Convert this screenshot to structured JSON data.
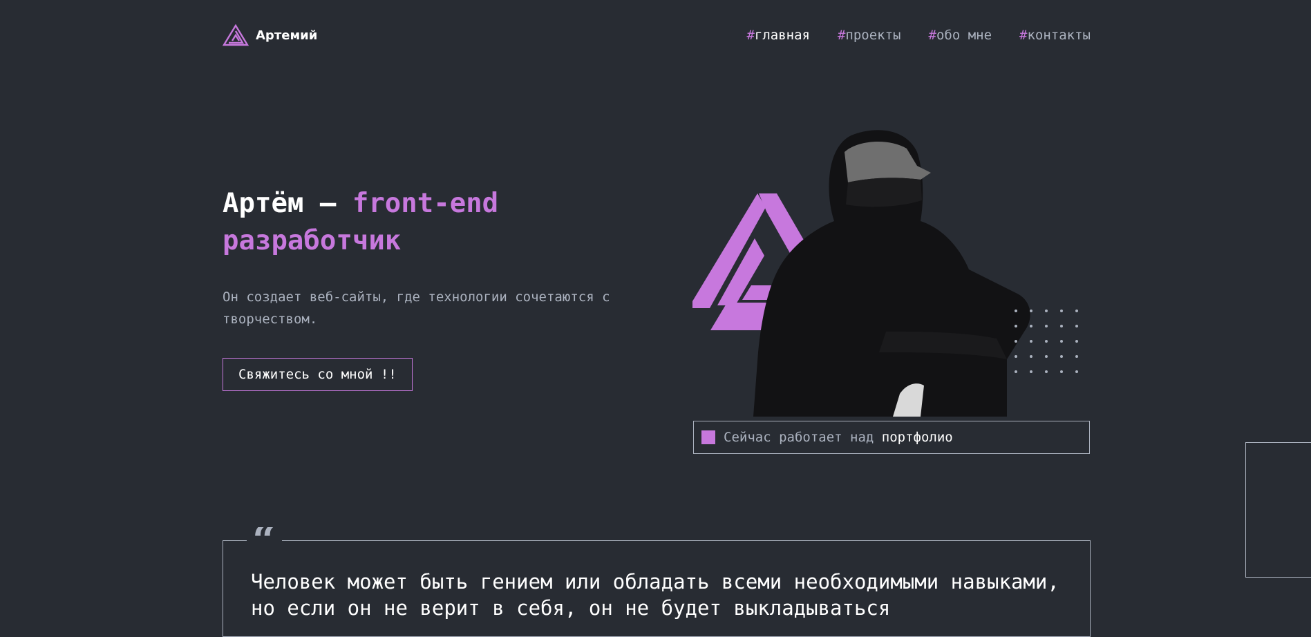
{
  "colors": {
    "background": "#282c33",
    "accent": "#c778dd",
    "text": "#abb2bf",
    "heading": "#ffffff"
  },
  "header": {
    "logo_icon": "triangle-logo-icon",
    "name": "Артемий",
    "nav": [
      {
        "hash": "#",
        "label": "главная",
        "active": true
      },
      {
        "hash": "#",
        "label": "проекты",
        "active": false
      },
      {
        "hash": "#",
        "label": "обо мне",
        "active": false
      },
      {
        "hash": "#",
        "label": "контакты",
        "active": false
      }
    ]
  },
  "hero": {
    "title_name": "Артём — ",
    "title_role": "front-end разработчик",
    "description": "Он создает веб-сайты, где технологии сочетаются с творчеством.",
    "cta_label": "Свяжитесь со мной !!"
  },
  "status": {
    "prefix": "Сейчас работает над ",
    "project": "портфолио"
  },
  "quote": {
    "mark": "“",
    "text": "Человек может быть гением или обладать всеми необходимыми навыками, но если он не верит в себя, он не будет выкладываться"
  }
}
